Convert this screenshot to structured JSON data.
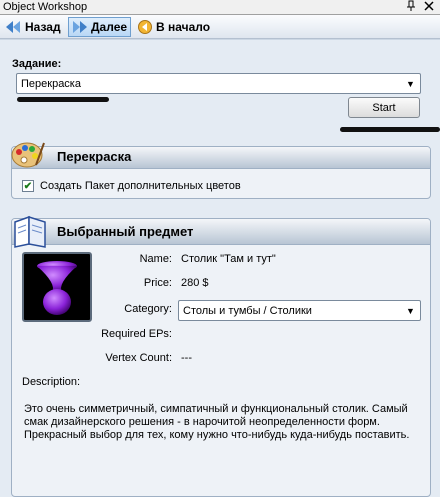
{
  "window": {
    "title": "Object Workshop",
    "pin_icon": "pin-icon",
    "close_icon": "close-icon"
  },
  "toolbar": {
    "back_label": "Назад",
    "next_label": "Далее",
    "home_label": "В начало"
  },
  "task": {
    "label": "Задание:",
    "selected": "Перекраска",
    "start_label": "Start"
  },
  "recolor_panel": {
    "title": "Перекраска",
    "checkbox_label": "Создать Пакет дополнительных цветов",
    "checkbox_checked": true
  },
  "item_panel": {
    "title": "Выбранный предмет",
    "name_label": "Name:",
    "name_value": "Столик \"Там и тут\"",
    "price_label": "Price:",
    "price_value": "280 $",
    "category_label": "Category:",
    "category_value": "Столы и тумбы / Столики",
    "eps_label": "Required EPs:",
    "eps_value": "",
    "vertex_label": "Vertex Count:",
    "vertex_value": "---",
    "description_label": "Description:",
    "description": "Это очень симметричный, симпатичный и функциональный столик. Самый смак дизайнерского решения - в нарочитой неопределенности форм. Прекрасный выбор для тех, кому нужно что-нибудь куда-нибудь поставить."
  },
  "colors": {
    "background": "#e4ebf3",
    "accent": "#6f9fcf",
    "object": "#8a22d8"
  }
}
